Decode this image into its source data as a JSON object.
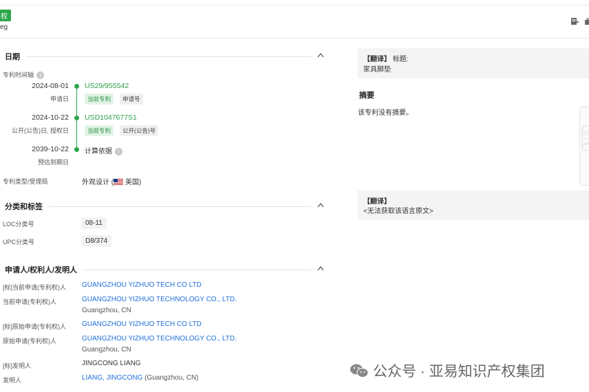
{
  "header": {
    "status_tag": "权",
    "short_text": "eg"
  },
  "dates_section": {
    "title": "日期",
    "timeline_label": "专利时间轴",
    "timeline": [
      {
        "date": "2024-08-01",
        "sub": "申请日",
        "number": "US29/955542",
        "chips": [
          "当前专利",
          "申请号"
        ]
      },
      {
        "date": "2024-10-22",
        "sub": "公开(公告)日, 授权日",
        "number": "USD1047677S1",
        "chips": [
          "当前专利",
          "公开(公告)号"
        ]
      },
      {
        "date": "2039-10-22",
        "sub": "预估到期日",
        "number": "计算依据",
        "chips": []
      }
    ],
    "type_label": "专利类型/受理局",
    "type_value_pre": "外观设计 (",
    "type_value_post": " 美国)"
  },
  "classification_section": {
    "title": "分类和标签",
    "loc_label": "LOC分类号",
    "loc_value": "08-11",
    "upc_label": "UPC分类号",
    "upc_value": "D8/374"
  },
  "applicant_section": {
    "title": "申请人/权利人/发明人",
    "rows": [
      {
        "label": "[标]当前申请(专利权)人",
        "value": "GUANGZHOU YIZHUO TECH CO LTD",
        "sub": ""
      },
      {
        "label": "当前申请(专利权)人",
        "value": "GUANGZHOU YIZHUO TECHNOLOGY CO., LTD.",
        "sub": "Guangzhou, CN"
      },
      {
        "label": "[标]原始申请(专利权)人",
        "value": "GUANGZHOU YIZHUO TECH CO LTD",
        "sub": ""
      },
      {
        "label": "原始申请(专利权)人",
        "value": "GUANGZHOU YIZHUO TECHNOLOGY CO., LTD.",
        "sub": "Guangzhou, CN"
      },
      {
        "label": "[标]发明人",
        "value": "JINGCONG LIANG",
        "sub": ""
      },
      {
        "label": "发明人",
        "value": "LIANG, JINGCONG",
        "sub": " (Guangzhou, CN)"
      }
    ]
  },
  "right_panel": {
    "translate_title_tag": "【翻译】",
    "translate_title_label": "标题:",
    "translate_title_value": "家具脚垫",
    "abstract_title": "摘要",
    "abstract_text": "该专利没有摘要。",
    "translate_abstract_tag": "【翻译】",
    "translate_abstract_text": "<无法获取该语言原文>"
  },
  "watermark": "公众号 · 亚易知识产权集团",
  "colors": {
    "accent_green": "#2ca64a",
    "link_blue": "#1e6fd9"
  }
}
